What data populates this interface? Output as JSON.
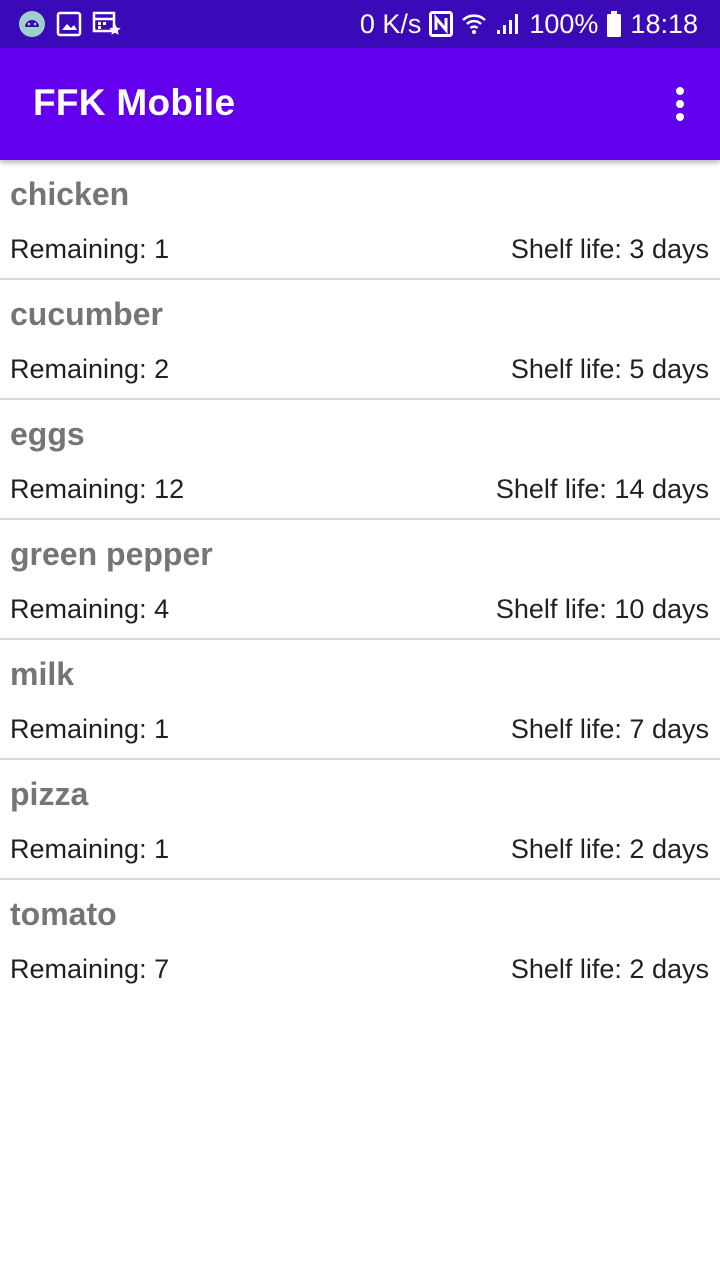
{
  "status_bar": {
    "icons_left": [
      "android-debug-icon",
      "gallery-icon",
      "calendar-icon"
    ],
    "network_speed": "0 K/s",
    "battery_percent": "100%",
    "time": "18:18",
    "icons_right": [
      "nfc-icon",
      "wifi-icon",
      "signal-icon",
      "battery-icon"
    ]
  },
  "app_bar": {
    "title": "FFK Mobile",
    "background": "#6200ee",
    "menu_icon": "more-vert-icon"
  },
  "items": [
    {
      "name": "chicken",
      "remaining": "Remaining: 1",
      "shelf_life": "Shelf life: 3 days"
    },
    {
      "name": "cucumber",
      "remaining": "Remaining: 2",
      "shelf_life": "Shelf life: 5 days"
    },
    {
      "name": "eggs",
      "remaining": "Remaining: 12",
      "shelf_life": "Shelf life: 14 days"
    },
    {
      "name": "green pepper",
      "remaining": "Remaining: 4",
      "shelf_life": "Shelf life: 10 days"
    },
    {
      "name": "milk",
      "remaining": "Remaining: 1",
      "shelf_life": "Shelf life: 7 days"
    },
    {
      "name": "pizza",
      "remaining": "Remaining: 1",
      "shelf_life": "Shelf life: 2 days"
    },
    {
      "name": "tomato",
      "remaining": "Remaining: 7",
      "shelf_life": "Shelf life: 2 days"
    }
  ]
}
